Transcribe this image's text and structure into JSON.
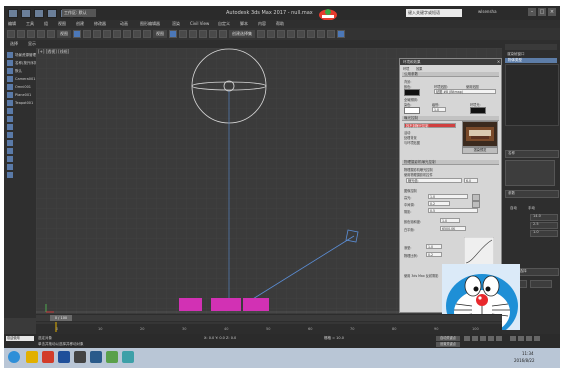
{
  "app": {
    "title": "Autodesk 3ds Max 2017 - null.max",
    "search_placeholder": "键入关键字或短语",
    "user": "wlsensha",
    "workspace": "工作区: 默认"
  },
  "menu": [
    "编辑",
    "工具",
    "组",
    "视图",
    "创建",
    "修改器",
    "动画",
    "图形编辑器",
    "渲染",
    "Civil View",
    "自定义",
    "脚本",
    "内容",
    "帮助"
  ],
  "toolbar": {
    "view_label": "视图",
    "create_label": "创建选择集"
  },
  "subbar": {
    "left": "选择",
    "mid": "显示"
  },
  "viewport": {
    "label": "[+] [透视] [线框]",
    "view_cube": "FRONT"
  },
  "left_panel": {
    "items": [
      "场景资源管理器",
      "名称(按升序排序)",
      "默认",
      "Camera001",
      "Omni001",
      "Plane001",
      "Teapot001"
    ]
  },
  "render_dialog": {
    "title": "环境和效果",
    "tabs": [
      "环境",
      "效果"
    ],
    "common_params": "公用参数",
    "background": "背景:",
    "color": "颜色:",
    "env_map": "环境贴图:",
    "use_map": "使用贴图",
    "map_name": "贴图 #8 (Bitmap) ",
    "global_lighting": "全局照明:",
    "tint": "染色:",
    "level": "级别:",
    "level_value": "1.0",
    "ambient": "环境光:",
    "exposure_header": "曝光控制",
    "exposure_value": "找不到曝光控制",
    "active": "活动",
    "process_bg": "处理背景",
    "and_env": "与环境贴图",
    "render_preview": "渲染预览",
    "physical_camera_header": "物理摄影机曝光控制",
    "exposure_for_non": "物理摄影机曝光控制",
    "use_physical": "使用物理摄影机控件",
    "exposure_label": "曝光值:",
    "exposure_value_field": "6.0",
    "image_control": "图像控制",
    "highlights": "高光:",
    "midtones": "中间调:",
    "shadows": "阴影:",
    "saturation": "颜色饱和度:",
    "white_point": "白平衡:",
    "color_temp": "6500.0K",
    "vignette": "渐晕:",
    "physical_scale": "物理比例:",
    "field_1": "1.0",
    "field_2": "0.2",
    "field_3": "0.5",
    "lookup": "使用 3ds Max 反射阴影"
  },
  "right_panel": {
    "title": "渲染帧窗口",
    "object_label": "物体类型",
    "section1": "名称",
    "section2": "参数",
    "item_a": "自动",
    "item_b": "手动",
    "value_a": "14.0",
    "value_b": "2.5",
    "value_c": "1.0",
    "section3": "浏览器/选择"
  },
  "timeline": {
    "frame": "0 / 100",
    "ticks": [
      "0",
      "10",
      "20",
      "30",
      "40",
      "50",
      "60",
      "70",
      "80",
      "90",
      "100"
    ]
  },
  "status": {
    "left": "欢迎使用 MAXScript",
    "message": "单击并拖动以选择并移动对象",
    "coords": "X: 0.0  Y: 0.0  Z: 0.0",
    "grid": "栅格 = 10.0",
    "autokey": "自动关键点",
    "set_key": "设置关键点",
    "selected": "选定对象"
  },
  "taskbar": {
    "time": "11:34",
    "date": "2016/8/22"
  },
  "colors": {
    "accent": "#4c78b8",
    "teapot": "#d231b4",
    "dialog_bg": "#d6d6d6"
  }
}
